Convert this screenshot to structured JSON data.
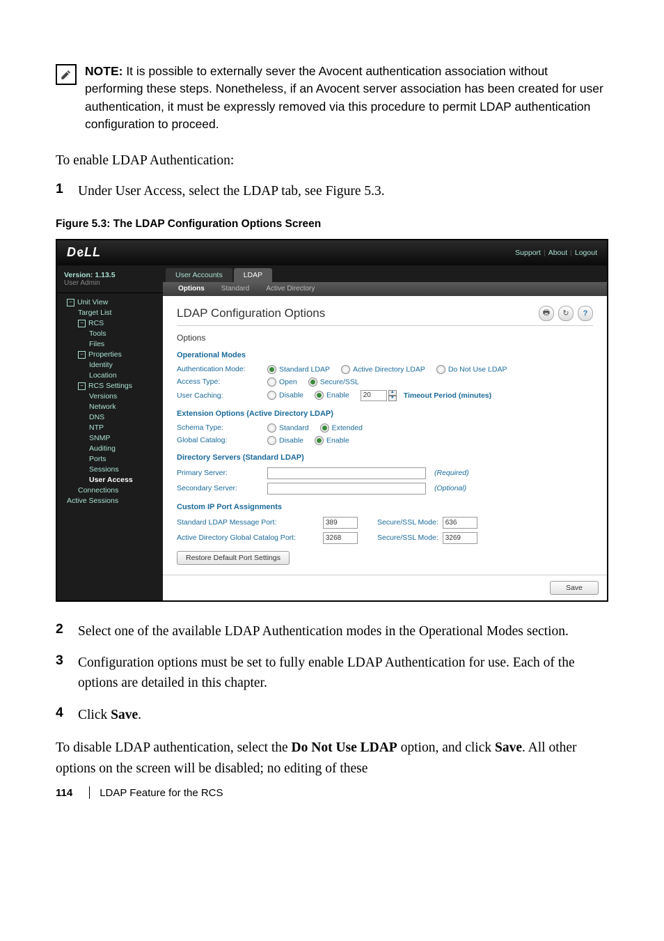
{
  "note": {
    "label": "NOTE:",
    "text": " It is possible to externally sever the Avocent authentication association without performing these steps. Nonetheless, if an Avocent server association has been created for user authentication, it must be expressly removed via this procedure to permit LDAP authentication configuration to proceed."
  },
  "enable_heading": "To enable LDAP Authentication:",
  "steps_top": {
    "n1": "1",
    "t1": "Under User Access, select the LDAP tab, see Figure 5.3."
  },
  "fig_caption": "Figure 5.3: The LDAP Configuration Options Screen",
  "screenshot": {
    "brand": "DELL",
    "top_links": {
      "support": "Support",
      "about": "About",
      "logout": "Logout"
    },
    "sidebar": {
      "version_label": "Version: 1.13.5",
      "user_admin": "User Admin",
      "items": {
        "unit_view": "Unit View",
        "target_list": "Target List",
        "rcs": "RCS",
        "tools": "Tools",
        "files": "Files",
        "properties": "Properties",
        "identity": "Identity",
        "location": "Location",
        "rcs_settings": "RCS Settings",
        "versions": "Versions",
        "network": "Network",
        "dns": "DNS",
        "ntp": "NTP",
        "snmp": "SNMP",
        "auditing": "Auditing",
        "ports": "Ports",
        "sessions": "Sessions",
        "user_access": "User Access",
        "connections": "Connections",
        "active_sessions": "Active Sessions"
      }
    },
    "tabs1": {
      "user_accounts": "User Accounts",
      "ldap": "LDAP"
    },
    "tabs2": {
      "options": "Options",
      "standard": "Standard",
      "active_directory": "Active Directory"
    },
    "content": {
      "title": "LDAP Configuration Options",
      "options_label": "Options",
      "op_modes": "Operational Modes",
      "auth_mode_label": "Authentication Mode:",
      "auth_opts": {
        "std": "Standard LDAP",
        "ad": "Active Directory LDAP",
        "none": "Do Not Use LDAP"
      },
      "access_type_label": "Access Type:",
      "access_opts": {
        "open": "Open",
        "secure": "Secure/SSL"
      },
      "user_caching_label": "User Caching:",
      "cache_opts": {
        "disable": "Disable",
        "enable": "Enable"
      },
      "cache_value": "20",
      "timeout_label": "Timeout Period (minutes)",
      "ext_opts": "Extension Options (Active Directory LDAP)",
      "schema_label": "Schema Type:",
      "schema_opts": {
        "std": "Standard",
        "ext": "Extended"
      },
      "gc_label": "Global Catalog:",
      "gc_opts": {
        "disable": "Disable",
        "enable": "Enable"
      },
      "dir_servers": "Directory Servers (Standard LDAP)",
      "primary_label": "Primary Server:",
      "primary_note": "(Required)",
      "secondary_label": "Secondary Server:",
      "secondary_note": "(Optional)",
      "custom_ports": "Custom IP Port Assignments",
      "std_port_label": "Standard LDAP Message Port:",
      "std_port_val": "389",
      "ssl_mode_label": "Secure/SSL Mode:",
      "ssl_port1": "636",
      "adgc_label": "Active Directory Global Catalog Port:",
      "adgc_val": "3268",
      "ssl_port2": "3269",
      "restore_btn": "Restore Default Port Settings",
      "save_btn": "Save"
    }
  },
  "steps_bottom": {
    "n2": "2",
    "t2": "Select one of the available LDAP Authentication modes in the Operational Modes section.",
    "n3": "3",
    "t3": "Configuration options must be set to fully enable LDAP Authentication for use. Each of the options are detailed in this chapter.",
    "n4": "4",
    "t4_a": "Click ",
    "t4_b": "Save",
    "t4_c": "."
  },
  "closing": {
    "a": "To disable LDAP authentication, select the ",
    "b": "Do Not Use LDAP",
    "c": " option, and click ",
    "d": "Save",
    "e": ". All other options on the screen will be disabled; no editing of these"
  },
  "footer": {
    "page": "114",
    "text": "LDAP Feature for the RCS"
  }
}
